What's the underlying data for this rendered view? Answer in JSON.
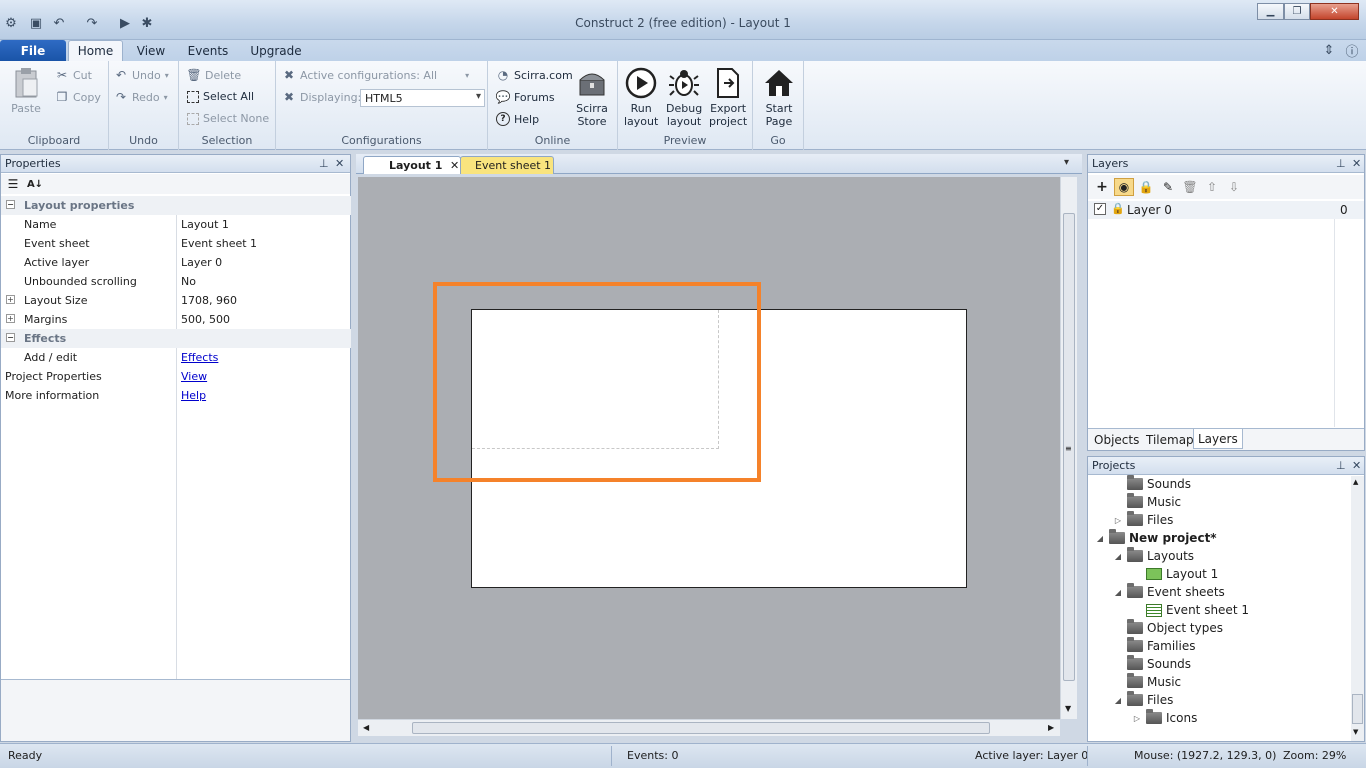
{
  "window": {
    "title": "Construct 2  (free edition) - Layout 1"
  },
  "ribbon_tabs": {
    "file": "File",
    "home": "Home",
    "view": "View",
    "events": "Events",
    "upgrade": "Upgrade"
  },
  "clipboard": {
    "paste": "Paste",
    "cut": "Cut",
    "copy": "Copy",
    "label": "Clipboard"
  },
  "undo": {
    "undo": "Undo",
    "redo": "Redo",
    "label": "Undo"
  },
  "selection": {
    "delete": "Delete",
    "select_all": "Select All",
    "select_none": "Select None",
    "label": "Selection"
  },
  "configurations": {
    "active": "Active configurations: All",
    "displaying_label": "Displaying:",
    "displaying_value": "HTML5",
    "label": "Configurations"
  },
  "online": {
    "scirra": "Scirra.com",
    "forums": "Forums",
    "help": "Help",
    "store_line1": "Scirra",
    "store_line2": "Store",
    "label": "Online"
  },
  "preview": {
    "run_l1": "Run",
    "run_l2": "layout",
    "debug_l1": "Debug",
    "debug_l2": "layout",
    "export_l1": "Export",
    "export_l2": "project",
    "label": "Preview"
  },
  "go": {
    "start_l1": "Start",
    "start_l2": "Page",
    "label": "Go"
  },
  "properties": {
    "title": "Properties",
    "category_layout": "Layout properties",
    "category_effects": "Effects",
    "rows": [
      {
        "key": "Name",
        "value": "Layout 1"
      },
      {
        "key": "Event sheet",
        "value": "Event sheet 1"
      },
      {
        "key": "Active layer",
        "value": "Layer 0"
      },
      {
        "key": "Unbounded scrolling",
        "value": "No"
      },
      {
        "key": "Layout Size",
        "value": "1708, 960"
      },
      {
        "key": "Margins",
        "value": "500, 500"
      }
    ],
    "add_edit": {
      "key": "Add / edit",
      "value": "Effects"
    },
    "project_properties": {
      "key": "Project Properties",
      "value": "View"
    },
    "more_info": {
      "key": "More information",
      "value": "Help"
    }
  },
  "editor": {
    "tab_layout": "Layout 1",
    "tab_event_sheet": "Event sheet 1"
  },
  "layers": {
    "title": "Layers",
    "items": [
      {
        "name": "Layer 0",
        "index": "0"
      }
    ],
    "bottom_tabs": {
      "objects": "Objects",
      "tilemap": "Tilemap",
      "layers": "Layers"
    }
  },
  "projects": {
    "title": "Projects",
    "tree": {
      "sounds_top": "Sounds",
      "music_top": "Music",
      "files_top": "Files",
      "project": "New project*",
      "layouts": "Layouts",
      "layout1": "Layout 1",
      "event_sheets": "Event sheets",
      "event_sheet1": "Event sheet 1",
      "object_types": "Object types",
      "families": "Families",
      "sounds": "Sounds",
      "music": "Music",
      "files": "Files",
      "icons": "Icons"
    }
  },
  "status": {
    "ready": "Ready",
    "events": "Events: 0",
    "active_layer": "Active layer: Layer 0",
    "mouse": "Mouse: (1927.2, 129.3, 0)",
    "zoom": "Zoom: 29%"
  },
  "colors": {
    "accent_orange": "#f5822a",
    "file_tab": "#1a54a8",
    "event_tab": "#f9e47e"
  }
}
